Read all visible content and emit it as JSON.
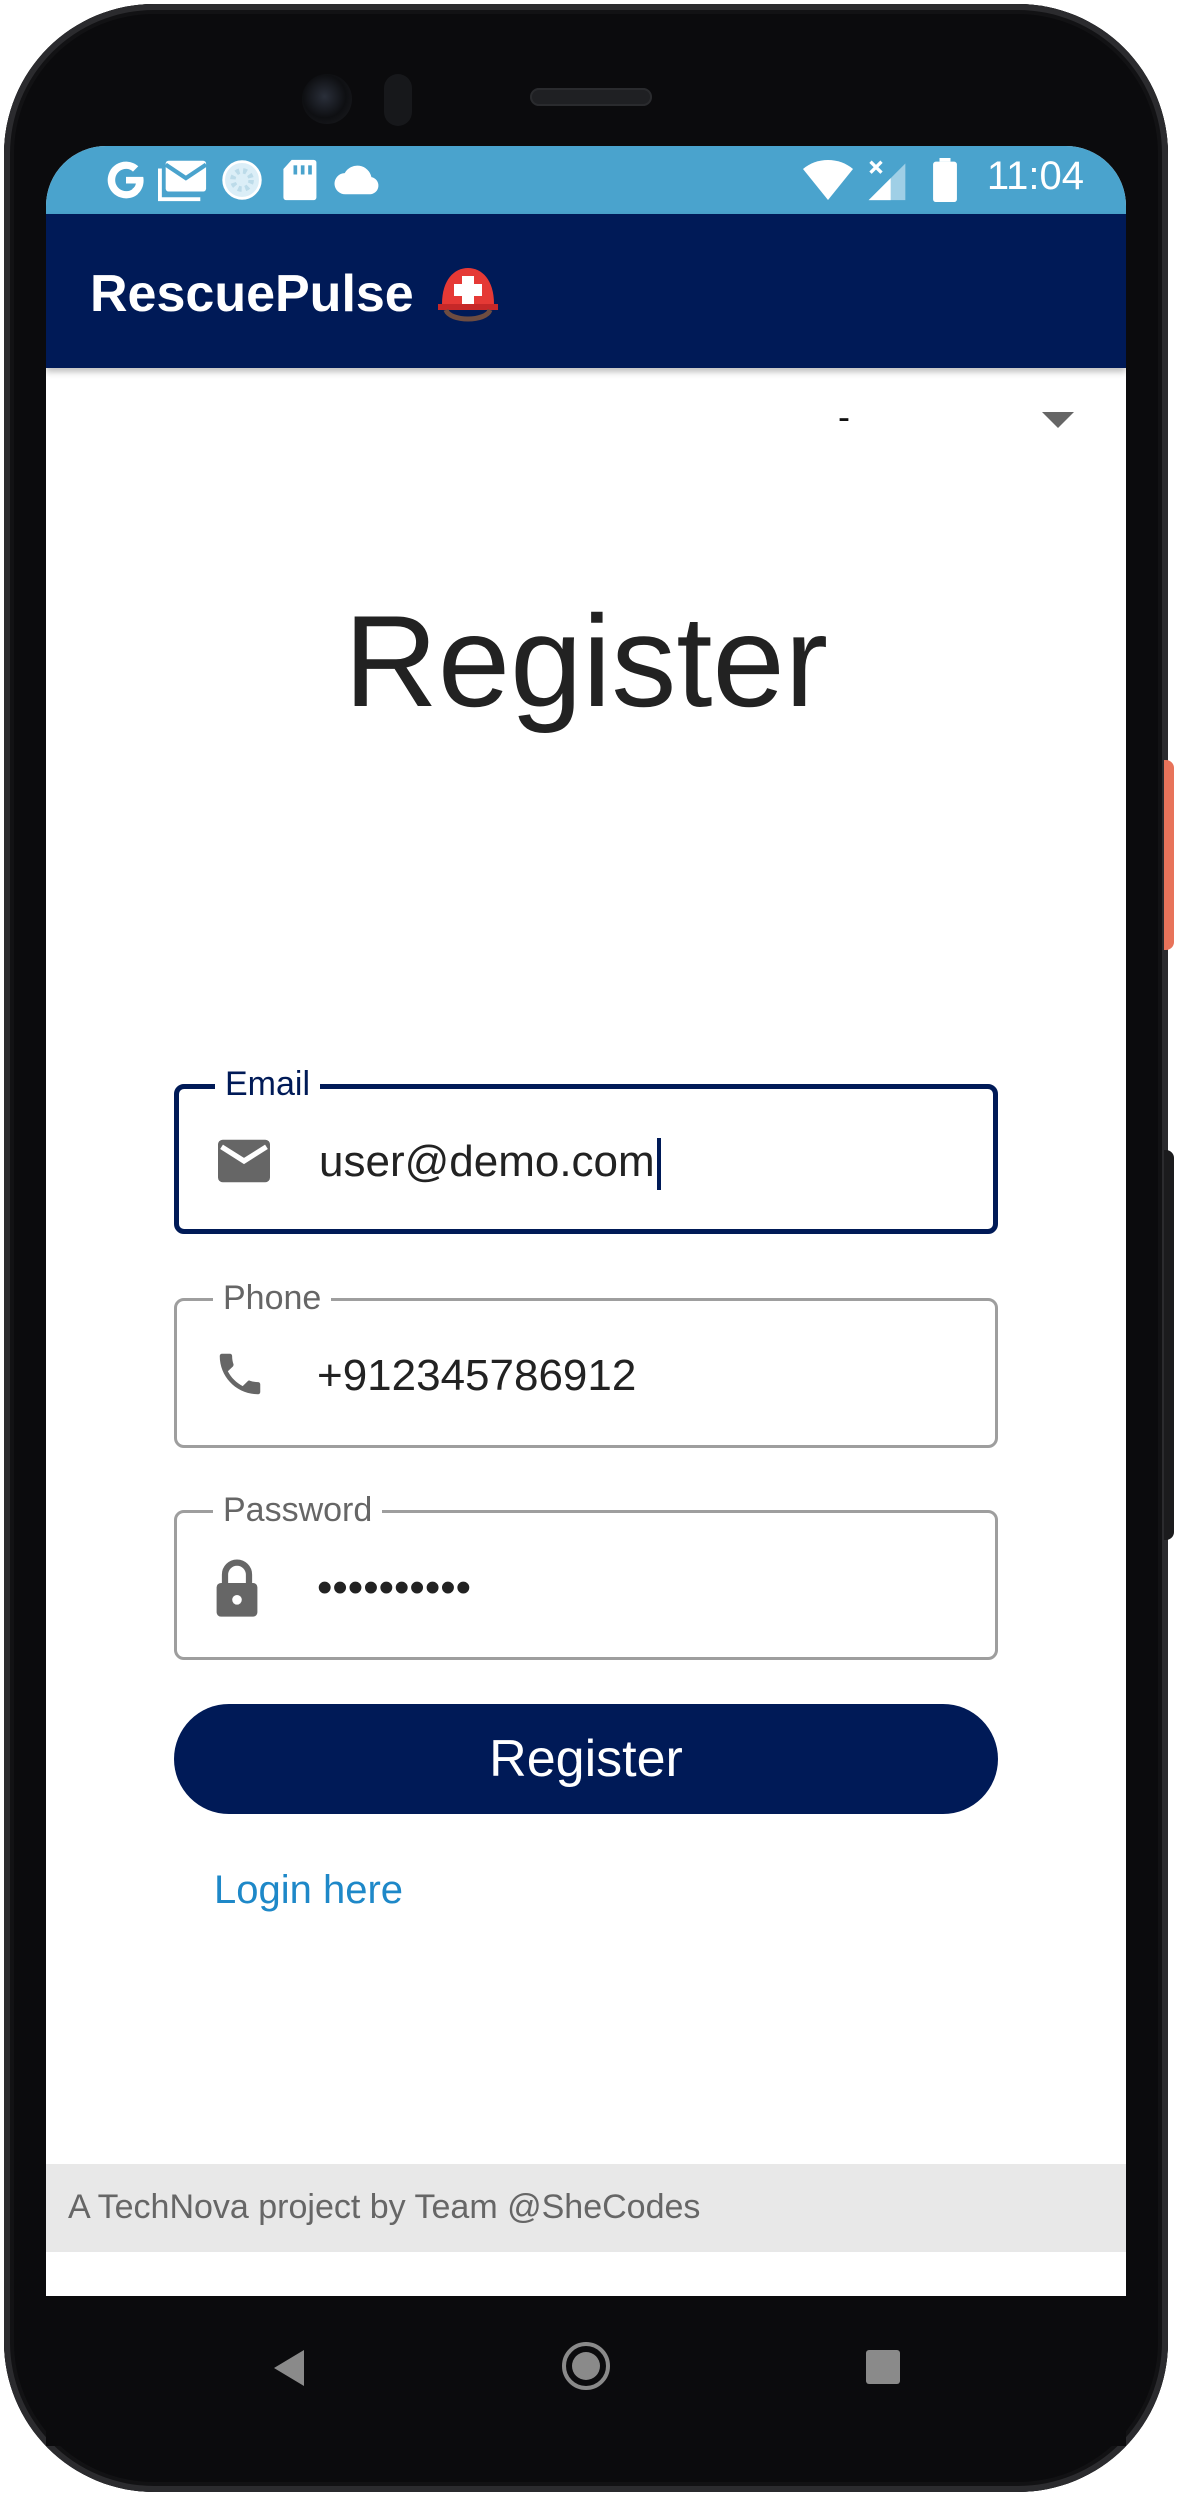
{
  "status_bar": {
    "time": "11:04",
    "left_icons": [
      "google-icon",
      "gmail-icon",
      "sync-icon",
      "sdcard-icon",
      "cloud-icon"
    ],
    "right_icons": [
      "wifi-icon",
      "signal-icon",
      "battery-icon"
    ]
  },
  "app_bar": {
    "title": "RescuePulse",
    "emoji_icon": "rescue-helmet-icon",
    "color": "#001a57"
  },
  "language_select": {
    "value": "-"
  },
  "heading": "Register",
  "form": {
    "email": {
      "label": "Email",
      "value": "user@demo.com",
      "icon": "mail-icon"
    },
    "phone": {
      "label": "Phone",
      "value": "+912345786912",
      "icon": "phone-icon"
    },
    "password": {
      "label": "Password",
      "value": "••••••••••",
      "icon": "lock-icon"
    },
    "submit_label": "Register",
    "login_link": "Login here"
  },
  "footer": {
    "text": "A TechNova project by Team @SheCodes"
  },
  "colors": {
    "status_bar": "#4aa3cd",
    "primary": "#001a57",
    "link": "#1e88c8"
  }
}
